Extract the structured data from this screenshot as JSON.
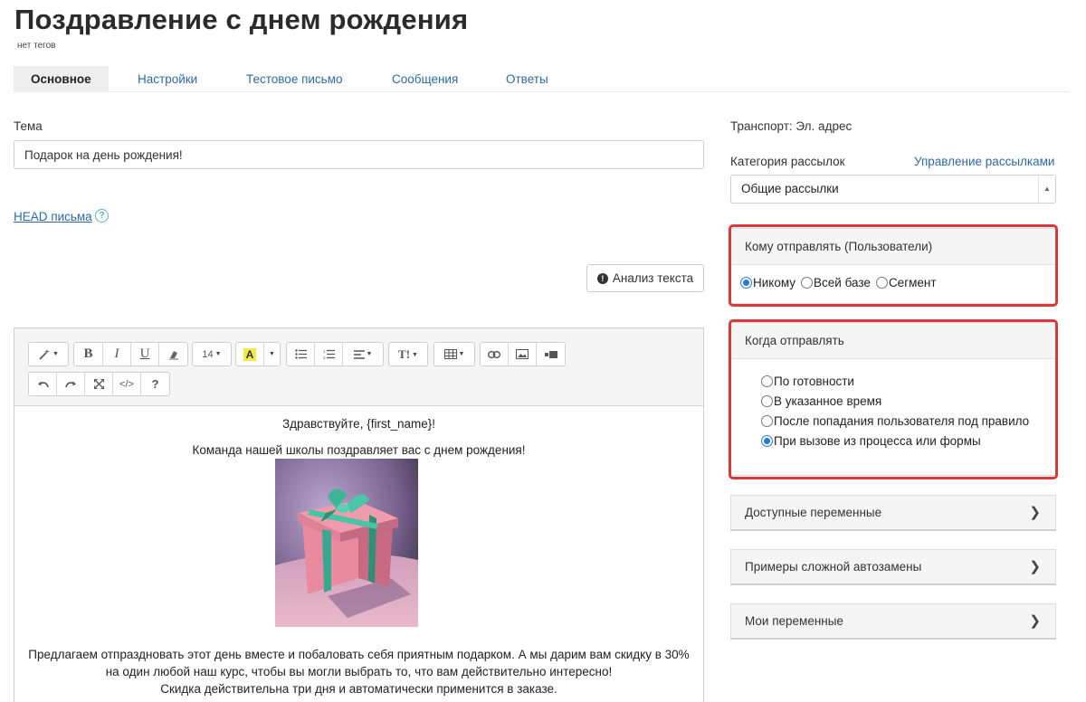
{
  "page": {
    "title": "Поздравление с днем рождения",
    "tags": "нет тегов"
  },
  "tabs": [
    {
      "label": "Основное",
      "active": true
    },
    {
      "label": "Настройки"
    },
    {
      "label": "Тестовое письмо"
    },
    {
      "label": "Сообщения"
    },
    {
      "label": "Ответы"
    }
  ],
  "subject": {
    "label": "Тема",
    "value": "Подарок на день рождения!"
  },
  "head_link": "HEAD письма",
  "analyze_button": "Анализ текста",
  "editor": {
    "toolbar": {
      "font_size": "14"
    },
    "content": {
      "greeting": "Здравствуйте, {first_name}!",
      "line2": "Команда нашей школы поздравляет вас с днем рождения!",
      "paragraph": [
        "Предлагаем отпраздновать этот день вместе и побаловать себя приятным подарком. А мы дарим вам скидку в 30%",
        "на один любой наш курс, чтобы вы могли выбрать то, что вам действительно интересно!",
        "Скидка действительна три дня и автоматически применится в заказе."
      ]
    }
  },
  "sidebar": {
    "transport": "Транспорт: Эл. адрес",
    "category_label": "Категория рассылок",
    "manage_link": "Управление рассылками",
    "category_value": "Общие рассылки",
    "who": {
      "title": "Кому отправлять (Пользователи)",
      "options": [
        "Никому",
        "Всей базе",
        "Сегмент"
      ],
      "selected": "Никому"
    },
    "when": {
      "title": "Когда отправлять",
      "options": [
        "По готовности",
        "В указанное время",
        "После попадания пользователя под правило",
        "При вызове из процесса или формы"
      ],
      "selected": "При вызове из процесса или формы"
    },
    "accordions": [
      "Доступные переменные",
      "Примеры сложной автозамены",
      "Мои переменные"
    ]
  },
  "colors": {
    "accent": "#2f6aa3",
    "highlight": "#d53b3b",
    "radio": "#2a78d6"
  }
}
